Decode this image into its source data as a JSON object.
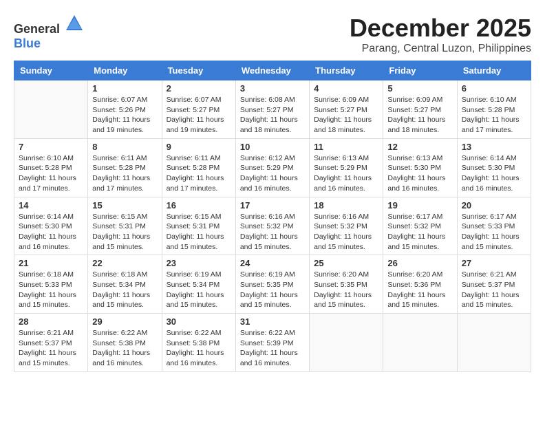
{
  "logo": {
    "general": "General",
    "blue": "Blue"
  },
  "header": {
    "month": "December 2025",
    "location": "Parang, Central Luzon, Philippines"
  },
  "weekdays": [
    "Sunday",
    "Monday",
    "Tuesday",
    "Wednesday",
    "Thursday",
    "Friday",
    "Saturday"
  ],
  "weeks": [
    [
      {
        "day": "",
        "info": ""
      },
      {
        "day": "1",
        "info": "Sunrise: 6:07 AM\nSunset: 5:26 PM\nDaylight: 11 hours\nand 19 minutes."
      },
      {
        "day": "2",
        "info": "Sunrise: 6:07 AM\nSunset: 5:27 PM\nDaylight: 11 hours\nand 19 minutes."
      },
      {
        "day": "3",
        "info": "Sunrise: 6:08 AM\nSunset: 5:27 PM\nDaylight: 11 hours\nand 18 minutes."
      },
      {
        "day": "4",
        "info": "Sunrise: 6:09 AM\nSunset: 5:27 PM\nDaylight: 11 hours\nand 18 minutes."
      },
      {
        "day": "5",
        "info": "Sunrise: 6:09 AM\nSunset: 5:27 PM\nDaylight: 11 hours\nand 18 minutes."
      },
      {
        "day": "6",
        "info": "Sunrise: 6:10 AM\nSunset: 5:28 PM\nDaylight: 11 hours\nand 17 minutes."
      }
    ],
    [
      {
        "day": "7",
        "info": "Sunrise: 6:10 AM\nSunset: 5:28 PM\nDaylight: 11 hours\nand 17 minutes."
      },
      {
        "day": "8",
        "info": "Sunrise: 6:11 AM\nSunset: 5:28 PM\nDaylight: 11 hours\nand 17 minutes."
      },
      {
        "day": "9",
        "info": "Sunrise: 6:11 AM\nSunset: 5:28 PM\nDaylight: 11 hours\nand 17 minutes."
      },
      {
        "day": "10",
        "info": "Sunrise: 6:12 AM\nSunset: 5:29 PM\nDaylight: 11 hours\nand 16 minutes."
      },
      {
        "day": "11",
        "info": "Sunrise: 6:13 AM\nSunset: 5:29 PM\nDaylight: 11 hours\nand 16 minutes."
      },
      {
        "day": "12",
        "info": "Sunrise: 6:13 AM\nSunset: 5:30 PM\nDaylight: 11 hours\nand 16 minutes."
      },
      {
        "day": "13",
        "info": "Sunrise: 6:14 AM\nSunset: 5:30 PM\nDaylight: 11 hours\nand 16 minutes."
      }
    ],
    [
      {
        "day": "14",
        "info": "Sunrise: 6:14 AM\nSunset: 5:30 PM\nDaylight: 11 hours\nand 16 minutes."
      },
      {
        "day": "15",
        "info": "Sunrise: 6:15 AM\nSunset: 5:31 PM\nDaylight: 11 hours\nand 15 minutes."
      },
      {
        "day": "16",
        "info": "Sunrise: 6:15 AM\nSunset: 5:31 PM\nDaylight: 11 hours\nand 15 minutes."
      },
      {
        "day": "17",
        "info": "Sunrise: 6:16 AM\nSunset: 5:32 PM\nDaylight: 11 hours\nand 15 minutes."
      },
      {
        "day": "18",
        "info": "Sunrise: 6:16 AM\nSunset: 5:32 PM\nDaylight: 11 hours\nand 15 minutes."
      },
      {
        "day": "19",
        "info": "Sunrise: 6:17 AM\nSunset: 5:32 PM\nDaylight: 11 hours\nand 15 minutes."
      },
      {
        "day": "20",
        "info": "Sunrise: 6:17 AM\nSunset: 5:33 PM\nDaylight: 11 hours\nand 15 minutes."
      }
    ],
    [
      {
        "day": "21",
        "info": "Sunrise: 6:18 AM\nSunset: 5:33 PM\nDaylight: 11 hours\nand 15 minutes."
      },
      {
        "day": "22",
        "info": "Sunrise: 6:18 AM\nSunset: 5:34 PM\nDaylight: 11 hours\nand 15 minutes."
      },
      {
        "day": "23",
        "info": "Sunrise: 6:19 AM\nSunset: 5:34 PM\nDaylight: 11 hours\nand 15 minutes."
      },
      {
        "day": "24",
        "info": "Sunrise: 6:19 AM\nSunset: 5:35 PM\nDaylight: 11 hours\nand 15 minutes."
      },
      {
        "day": "25",
        "info": "Sunrise: 6:20 AM\nSunset: 5:35 PM\nDaylight: 11 hours\nand 15 minutes."
      },
      {
        "day": "26",
        "info": "Sunrise: 6:20 AM\nSunset: 5:36 PM\nDaylight: 11 hours\nand 15 minutes."
      },
      {
        "day": "27",
        "info": "Sunrise: 6:21 AM\nSunset: 5:37 PM\nDaylight: 11 hours\nand 15 minutes."
      }
    ],
    [
      {
        "day": "28",
        "info": "Sunrise: 6:21 AM\nSunset: 5:37 PM\nDaylight: 11 hours\nand 15 minutes."
      },
      {
        "day": "29",
        "info": "Sunrise: 6:22 AM\nSunset: 5:38 PM\nDaylight: 11 hours\nand 16 minutes."
      },
      {
        "day": "30",
        "info": "Sunrise: 6:22 AM\nSunset: 5:38 PM\nDaylight: 11 hours\nand 16 minutes."
      },
      {
        "day": "31",
        "info": "Sunrise: 6:22 AM\nSunset: 5:39 PM\nDaylight: 11 hours\nand 16 minutes."
      },
      {
        "day": "",
        "info": ""
      },
      {
        "day": "",
        "info": ""
      },
      {
        "day": "",
        "info": ""
      }
    ]
  ]
}
